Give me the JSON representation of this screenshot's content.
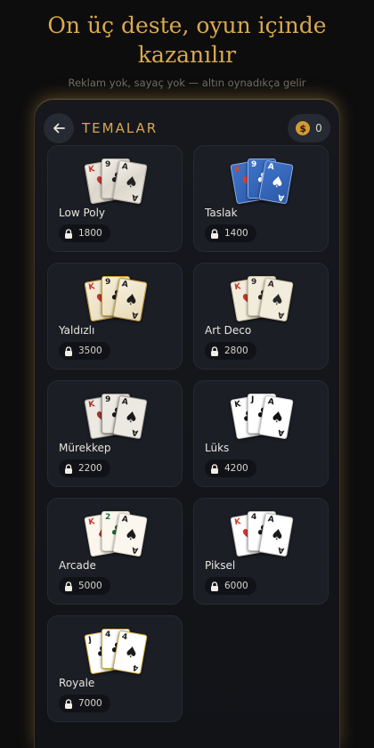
{
  "promo": {
    "title": "On üç deste, oyun içinde kazanılır",
    "subtitle": "Reklam yok, sayaç yok — altın oynadıkça gelir"
  },
  "header": {
    "title": "TEMALAR",
    "back_icon": "arrow-left-icon",
    "coins": "0",
    "coin_symbol": "$"
  },
  "colors": {
    "accent": "#d9a94f",
    "tile": "#1b1e25",
    "background": "#0d0d0e"
  },
  "themes": [
    {
      "name": "Low Poly",
      "price": "1800",
      "style": "lowpoly"
    },
    {
      "name": "Taslak",
      "price": "1400",
      "style": "blue"
    },
    {
      "name": "Yaldızlı",
      "price": "3500",
      "style": "gilded"
    },
    {
      "name": "Art Deco",
      "price": "2800",
      "style": "deco"
    },
    {
      "name": "Mürekkep",
      "price": "2200",
      "style": "ink"
    },
    {
      "name": "Lüks",
      "price": "4200",
      "style": "luxe"
    },
    {
      "name": "Arcade",
      "price": "5000",
      "style": "arcade"
    },
    {
      "name": "Piksel",
      "price": "6000",
      "style": "pixel"
    },
    {
      "name": "Royale",
      "price": "7000",
      "style": "royale"
    }
  ],
  "preview_cards": [
    {
      "rank": "K",
      "suit": "♥"
    },
    {
      "rank": "9",
      "suit": "♣"
    },
    {
      "rank": "A",
      "suit": "♠"
    }
  ]
}
